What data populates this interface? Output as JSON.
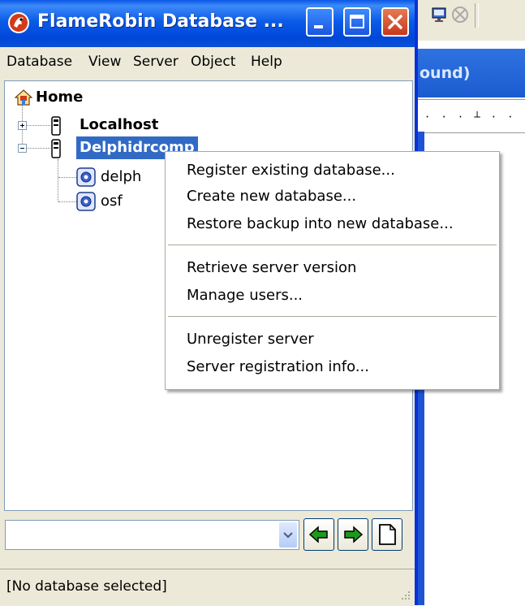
{
  "window": {
    "title": "FlameRobin Database ...",
    "buttons": {
      "minimize": "minimize",
      "maximize": "maximize",
      "close": "close"
    }
  },
  "menubar": {
    "items": [
      "Database",
      "View",
      "Server",
      "Object",
      "Help"
    ]
  },
  "tree": {
    "home": "Home",
    "servers": [
      {
        "label": "Localhost",
        "expanded": false
      },
      {
        "label": "Delphidrcomp",
        "expanded": true,
        "selected": true,
        "databases": [
          "delph",
          "osf"
        ]
      }
    ]
  },
  "background_app": {
    "header_text": "ound)"
  },
  "context_menu": {
    "items": [
      "Register existing database...",
      "Create new database...",
      "Restore backup into new database...",
      "Retrieve server version",
      "Manage users...",
      "Unregister server",
      "Server registration info..."
    ]
  },
  "bottombar": {
    "combo_value": "",
    "buttons": [
      "back-arrow-icon",
      "forward-arrow-icon",
      "new-document-icon"
    ]
  },
  "statusbar": {
    "text": "[No database selected]"
  },
  "colors": {
    "selection": "#316ac5",
    "titlebar": "#0a57e7",
    "close": "#c8391b",
    "arrow": "#1c9a1c"
  }
}
